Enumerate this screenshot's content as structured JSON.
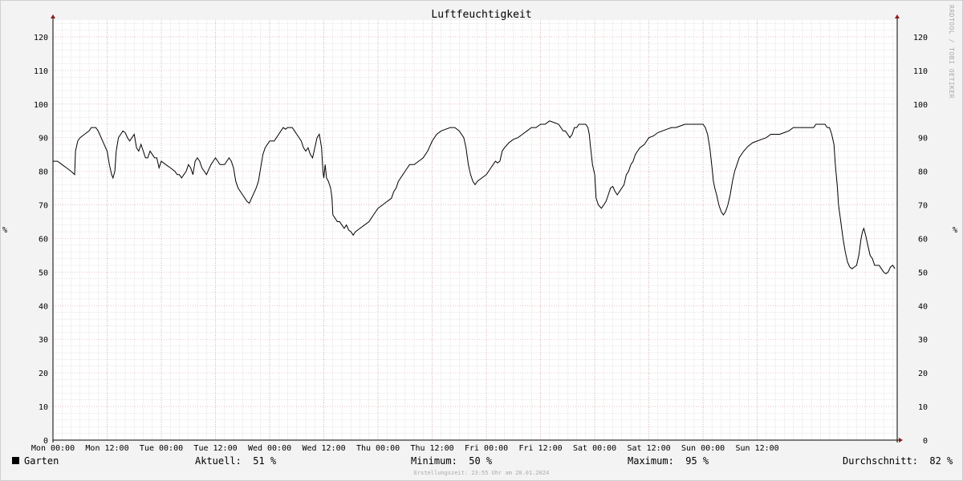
{
  "chart_data": {
    "type": "line",
    "title": "Luftfeuchtigkeit",
    "ylabel": "%",
    "ylim": [
      0,
      125
    ],
    "yticks": [
      0,
      10,
      20,
      30,
      40,
      50,
      60,
      70,
      80,
      90,
      100,
      110,
      120
    ],
    "xlim": [
      0,
      168
    ],
    "xticks": [
      {
        "at": 0,
        "label": "Mon 00:00"
      },
      {
        "at": 12,
        "label": "Mon 12:00"
      },
      {
        "at": 24,
        "label": "Tue 00:00"
      },
      {
        "at": 36,
        "label": "Tue 12:00"
      },
      {
        "at": 48,
        "label": "Wed 00:00"
      },
      {
        "at": 60,
        "label": "Wed 12:00"
      },
      {
        "at": 72,
        "label": "Thu 00:00"
      },
      {
        "at": 84,
        "label": "Thu 12:00"
      },
      {
        "at": 96,
        "label": "Fri 00:00"
      },
      {
        "at": 108,
        "label": "Fri 12:00"
      },
      {
        "at": 120,
        "label": "Sat 00:00"
      },
      {
        "at": 132,
        "label": "Sat 12:00"
      },
      {
        "at": 144,
        "label": "Sun 00:00"
      },
      {
        "at": 156,
        "label": "Sun 12:00"
      }
    ],
    "grid": true,
    "series": [
      {
        "name": "Garten",
        "color": "#000000",
        "points": [
          [
            0,
            83
          ],
          [
            1,
            83
          ],
          [
            2,
            82
          ],
          [
            3,
            81
          ],
          [
            4,
            80
          ],
          [
            4.8,
            79
          ],
          [
            5,
            86
          ],
          [
            5.5,
            89
          ],
          [
            6,
            90
          ],
          [
            7,
            91
          ],
          [
            8,
            92
          ],
          [
            8.5,
            93
          ],
          [
            9.5,
            93
          ],
          [
            10,
            92
          ],
          [
            11,
            89
          ],
          [
            12,
            86
          ],
          [
            12.5,
            82
          ],
          [
            13,
            79
          ],
          [
            13.3,
            78
          ],
          [
            13.7,
            80
          ],
          [
            14,
            86
          ],
          [
            14.5,
            90
          ],
          [
            15,
            91
          ],
          [
            15.5,
            92
          ],
          [
            16,
            91.5
          ],
          [
            16.5,
            90
          ],
          [
            17,
            89
          ],
          [
            17.5,
            90
          ],
          [
            18,
            91
          ],
          [
            18.5,
            87
          ],
          [
            19,
            86
          ],
          [
            19.5,
            88
          ],
          [
            20,
            86
          ],
          [
            20.5,
            84
          ],
          [
            21,
            84
          ],
          [
            21.5,
            86
          ],
          [
            22,
            85
          ],
          [
            22.5,
            84
          ],
          [
            23,
            84
          ],
          [
            23.5,
            81
          ],
          [
            24,
            83
          ],
          [
            25,
            82
          ],
          [
            26,
            81
          ],
          [
            27,
            80
          ],
          [
            27.5,
            79
          ],
          [
            28,
            79
          ],
          [
            28.5,
            78
          ],
          [
            29,
            79
          ],
          [
            29.5,
            80
          ],
          [
            30,
            82
          ],
          [
            30.5,
            81
          ],
          [
            31,
            79
          ],
          [
            31.5,
            83
          ],
          [
            32,
            84
          ],
          [
            32.5,
            83
          ],
          [
            33,
            81
          ],
          [
            33.5,
            80
          ],
          [
            34,
            79
          ],
          [
            35,
            82
          ],
          [
            35.5,
            83
          ],
          [
            36,
            84
          ],
          [
            37,
            82
          ],
          [
            38,
            82
          ],
          [
            38.5,
            83
          ],
          [
            39,
            84
          ],
          [
            39.5,
            83
          ],
          [
            40,
            81
          ],
          [
            40.5,
            77
          ],
          [
            41,
            75
          ],
          [
            42,
            73
          ],
          [
            43,
            71
          ],
          [
            43.5,
            70.5
          ],
          [
            44,
            72
          ],
          [
            45,
            75
          ],
          [
            45.5,
            77
          ],
          [
            46,
            81
          ],
          [
            46.5,
            85
          ],
          [
            47,
            87
          ],
          [
            48,
            89
          ],
          [
            49,
            89
          ],
          [
            49.5,
            90
          ],
          [
            50,
            91
          ],
          [
            50.5,
            92
          ],
          [
            51,
            93
          ],
          [
            51.5,
            92.5
          ],
          [
            52,
            93
          ],
          [
            53,
            93
          ],
          [
            53.5,
            92
          ],
          [
            54,
            91
          ],
          [
            55,
            89
          ],
          [
            55.5,
            87
          ],
          [
            56,
            86
          ],
          [
            56.5,
            87
          ],
          [
            57,
            85
          ],
          [
            57.5,
            84
          ],
          [
            58,
            87
          ],
          [
            58.5,
            90
          ],
          [
            59,
            91
          ],
          [
            59.5,
            87
          ],
          [
            59.8,
            80
          ],
          [
            60,
            78
          ],
          [
            60.3,
            82
          ],
          [
            60.6,
            78
          ],
          [
            61,
            77
          ],
          [
            61.5,
            75
          ],
          [
            61.8,
            72
          ],
          [
            62,
            67
          ],
          [
            62.5,
            66
          ],
          [
            63,
            65
          ],
          [
            63.5,
            65
          ],
          [
            64,
            64
          ],
          [
            64.5,
            63
          ],
          [
            65,
            64
          ],
          [
            65.5,
            62.5
          ],
          [
            66,
            62
          ],
          [
            66.5,
            61
          ],
          [
            67,
            62
          ],
          [
            68,
            63
          ],
          [
            69,
            64
          ],
          [
            70,
            65
          ],
          [
            70.5,
            66
          ],
          [
            71,
            67
          ],
          [
            72,
            69
          ],
          [
            73,
            70
          ],
          [
            74,
            71
          ],
          [
            74.5,
            71.5
          ],
          [
            75,
            72
          ],
          [
            75.5,
            74
          ],
          [
            76,
            75
          ],
          [
            76.5,
            77
          ],
          [
            77,
            78
          ],
          [
            77.5,
            79
          ],
          [
            78,
            80
          ],
          [
            79,
            82
          ],
          [
            80,
            82
          ],
          [
            81,
            83
          ],
          [
            82,
            84
          ],
          [
            83,
            86
          ],
          [
            84,
            89
          ],
          [
            85,
            91
          ],
          [
            86,
            92
          ],
          [
            87,
            92.5
          ],
          [
            88,
            93
          ],
          [
            89,
            93
          ],
          [
            90,
            92
          ],
          [
            91,
            90
          ],
          [
            91.5,
            87
          ],
          [
            92,
            82
          ],
          [
            92.5,
            79
          ],
          [
            93,
            77
          ],
          [
            93.5,
            76
          ],
          [
            94,
            77
          ],
          [
            95,
            78
          ],
          [
            96,
            79
          ],
          [
            96.5,
            80
          ],
          [
            97,
            81
          ],
          [
            97.5,
            82
          ],
          [
            98,
            83
          ],
          [
            98.5,
            82.5
          ],
          [
            99,
            83
          ],
          [
            99.5,
            86
          ],
          [
            100,
            87
          ],
          [
            101,
            88.5
          ],
          [
            102,
            89.5
          ],
          [
            103,
            90
          ],
          [
            104,
            91
          ],
          [
            105,
            92
          ],
          [
            106,
            93
          ],
          [
            107,
            93
          ],
          [
            108,
            94
          ],
          [
            109,
            94
          ],
          [
            110,
            95
          ],
          [
            111,
            94.5
          ],
          [
            112,
            94
          ],
          [
            112.5,
            93
          ],
          [
            113,
            92
          ],
          [
            113.5,
            92
          ],
          [
            114,
            91
          ],
          [
            114.5,
            90
          ],
          [
            115,
            91
          ],
          [
            115.5,
            93
          ],
          [
            116,
            93
          ],
          [
            116.5,
            94
          ],
          [
            117,
            94
          ],
          [
            118,
            94
          ],
          [
            118.5,
            93
          ],
          [
            118.8,
            91
          ],
          [
            119,
            88
          ],
          [
            119.5,
            82
          ],
          [
            120,
            79
          ],
          [
            120.3,
            72
          ],
          [
            120.8,
            70
          ],
          [
            121.5,
            69
          ],
          [
            122,
            70
          ],
          [
            122.5,
            71
          ],
          [
            123,
            73
          ],
          [
            123.5,
            75
          ],
          [
            124,
            75.5
          ],
          [
            124.5,
            74
          ],
          [
            125,
            73
          ],
          [
            125.5,
            74
          ],
          [
            126,
            75
          ],
          [
            126.5,
            76
          ],
          [
            127,
            79
          ],
          [
            127.5,
            80
          ],
          [
            128,
            82
          ],
          [
            128.5,
            83
          ],
          [
            129,
            85
          ],
          [
            129.5,
            86
          ],
          [
            130,
            87
          ],
          [
            131,
            88
          ],
          [
            131.5,
            89
          ],
          [
            132,
            90
          ],
          [
            133,
            90.5
          ],
          [
            133.5,
            91
          ],
          [
            134,
            91.5
          ],
          [
            135,
            92
          ],
          [
            136,
            92.5
          ],
          [
            137,
            93
          ],
          [
            138,
            93
          ],
          [
            139,
            93.5
          ],
          [
            140,
            94
          ],
          [
            141,
            94
          ],
          [
            142,
            94
          ],
          [
            143,
            94
          ],
          [
            144,
            94
          ],
          [
            144.5,
            93
          ],
          [
            145,
            91
          ],
          [
            145.5,
            87
          ],
          [
            146,
            81
          ],
          [
            146.3,
            77
          ],
          [
            146.6,
            75
          ],
          [
            147,
            73
          ],
          [
            147.5,
            70
          ],
          [
            148,
            68
          ],
          [
            148.5,
            67
          ],
          [
            149,
            68
          ],
          [
            149.5,
            70
          ],
          [
            150,
            73
          ],
          [
            150.5,
            77
          ],
          [
            151,
            80
          ],
          [
            151.5,
            82
          ],
          [
            152,
            84
          ],
          [
            153,
            86
          ],
          [
            154,
            87.5
          ],
          [
            155,
            88.5
          ],
          [
            156,
            89
          ],
          [
            157,
            89.5
          ],
          [
            158,
            90
          ],
          [
            159,
            91
          ],
          [
            160,
            91
          ],
          [
            161,
            91
          ],
          [
            162,
            91.5
          ],
          [
            163,
            92
          ],
          [
            164,
            93
          ],
          [
            165,
            93
          ],
          [
            166,
            93
          ],
          [
            167,
            93
          ],
          [
            168,
            93
          ],
          [
            168.5,
            93
          ],
          [
            169,
            94
          ],
          [
            170,
            94
          ],
          [
            171,
            94
          ],
          [
            171.5,
            93
          ],
          [
            172,
            93
          ],
          [
            172.5,
            91
          ],
          [
            173,
            88
          ],
          [
            173.3,
            82
          ],
          [
            173.7,
            76
          ],
          [
            174,
            70
          ],
          [
            174.5,
            65
          ],
          [
            175,
            60
          ],
          [
            175.5,
            56
          ],
          [
            176,
            53
          ],
          [
            176.5,
            51.5
          ],
          [
            177,
            51
          ],
          [
            177.5,
            51.5
          ],
          [
            178,
            52
          ],
          [
            178.5,
            55
          ],
          [
            179,
            60
          ],
          [
            179.3,
            62
          ],
          [
            179.6,
            63
          ],
          [
            180,
            61
          ],
          [
            180.5,
            58
          ],
          [
            181,
            55
          ],
          [
            181.5,
            54
          ],
          [
            182,
            52
          ],
          [
            182.5,
            52
          ],
          [
            183,
            52
          ],
          [
            183.5,
            51
          ],
          [
            184,
            50
          ],
          [
            184.5,
            49.5
          ],
          [
            185,
            50
          ],
          [
            185.5,
            51.5
          ],
          [
            186,
            52
          ],
          [
            186.5,
            51
          ]
        ]
      }
    ]
  },
  "legend": {
    "series_label": "Garten",
    "current": "Aktuell:  51 %",
    "minimum": "Minimum:  50 %",
    "maximum": "Maximum:  95 %",
    "average": "Durchschnitt:  82 %"
  },
  "watermark": "RRDTOOL / TOBI OETIKER",
  "footer": "Erstellungszeit: 23:55 Uhr am 28.01.2024",
  "colors": {
    "line": "#000000",
    "axis": "#000000",
    "arrow": "#8b1a1a",
    "grid_major": "#e2b4b4",
    "grid_minor": "#cfcfcf",
    "plot_bg": "#ffffff"
  }
}
